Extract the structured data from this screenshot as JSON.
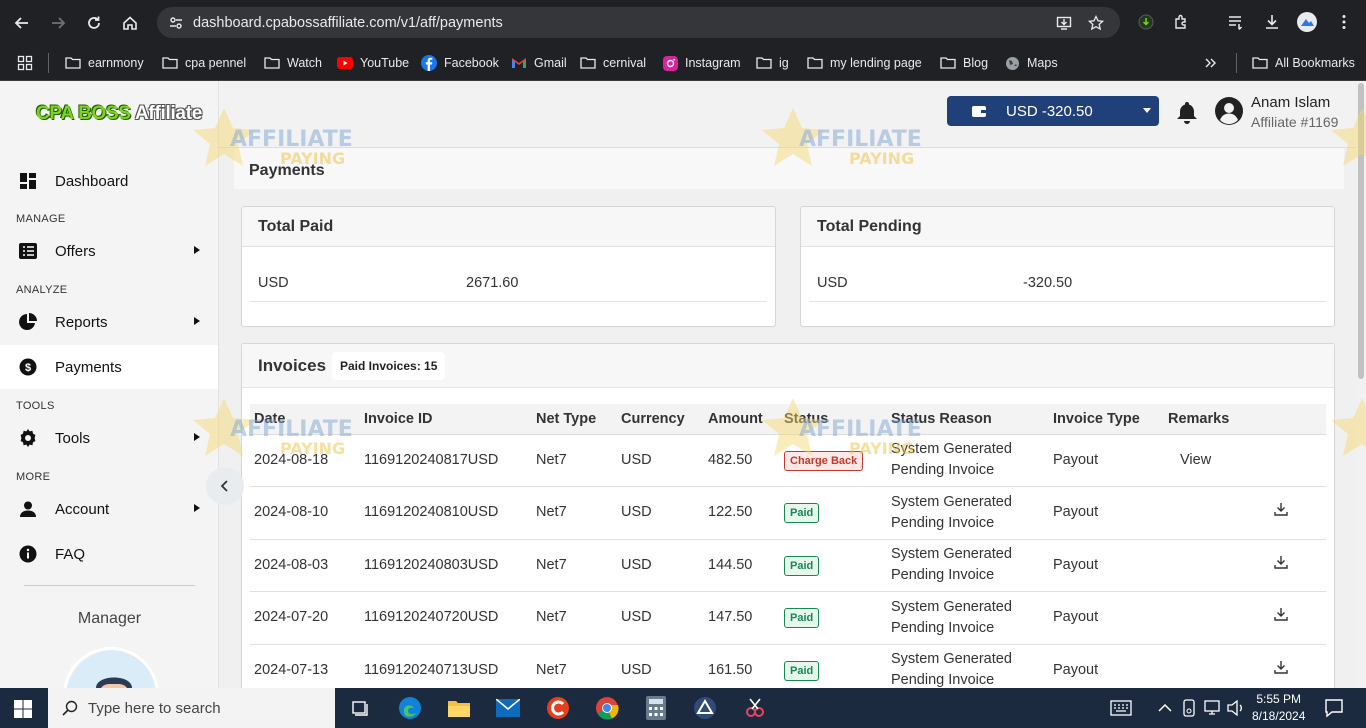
{
  "browser": {
    "url": "dashboard.cpabossaffiliate.com/v1/aff/payments",
    "bookmarks": [
      "earnmony",
      "cpa pennel",
      "Watch",
      "YouTube",
      "Facebook",
      "Gmail",
      "cernival",
      "Instagram",
      "ig",
      "my lending page",
      "Blog",
      "Maps"
    ],
    "all_bookmarks": "All Bookmarks"
  },
  "brand": {
    "logo_part1": "CPA BOSS",
    "logo_part2": "Affiliate"
  },
  "sidebar": {
    "dashboard": "Dashboard",
    "sec_manage": "MANAGE",
    "offers": "Offers",
    "sec_analyze": "ANALYZE",
    "reports": "Reports",
    "payments": "Payments",
    "sec_tools": "TOOLS",
    "tools": "Tools",
    "sec_more": "MORE",
    "account": "Account",
    "faq": "FAQ",
    "manager": "Manager"
  },
  "header": {
    "balance": "USD -320.50",
    "user_name": "Anam Islam",
    "user_id": "Affiliate #1169"
  },
  "page": {
    "title": "Payments",
    "total_paid": {
      "title": "Total Paid",
      "currency": "USD",
      "value": "2671.60"
    },
    "total_pending": {
      "title": "Total Pending",
      "currency": "USD",
      "value": "-320.50"
    }
  },
  "invoices": {
    "title": "Invoices",
    "badge": "Paid Invoices: 15",
    "columns": [
      "Date",
      "Invoice ID",
      "Net Type",
      "Currency",
      "Amount",
      "Status",
      "Status Reason",
      "Invoice Type",
      "Remarks"
    ],
    "rows": [
      {
        "date": "2024-08-18",
        "id": "1169120240817USD",
        "net": "Net7",
        "cur": "USD",
        "amount": "482.50",
        "status": "Charge Back",
        "reason1": "System Generated",
        "reason2": "Pending Invoice",
        "type": "Payout",
        "remarks": "View"
      },
      {
        "date": "2024-08-10",
        "id": "1169120240810USD",
        "net": "Net7",
        "cur": "USD",
        "amount": "122.50",
        "status": "Paid",
        "reason1": "System Generated",
        "reason2": "Pending Invoice",
        "type": "Payout",
        "remarks": ""
      },
      {
        "date": "2024-08-03",
        "id": "1169120240803USD",
        "net": "Net7",
        "cur": "USD",
        "amount": "144.50",
        "status": "Paid",
        "reason1": "System Generated",
        "reason2": "Pending Invoice",
        "type": "Payout",
        "remarks": ""
      },
      {
        "date": "2024-07-20",
        "id": "1169120240720USD",
        "net": "Net7",
        "cur": "USD",
        "amount": "147.50",
        "status": "Paid",
        "reason1": "System Generated",
        "reason2": "Pending Invoice",
        "type": "Payout",
        "remarks": ""
      },
      {
        "date": "2024-07-13",
        "id": "1169120240713USD",
        "net": "Net7",
        "cur": "USD",
        "amount": "161.50",
        "status": "Paid",
        "reason1": "System Generated",
        "reason2": "Pending Invoice",
        "type": "Payout",
        "remarks": ""
      }
    ]
  },
  "watermark": {
    "line1": "AFFILIATE",
    "line2": "PAYING"
  },
  "taskbar": {
    "search_placeholder": "Type here to search",
    "time": "5:55 PM",
    "date": "8/18/2024"
  }
}
